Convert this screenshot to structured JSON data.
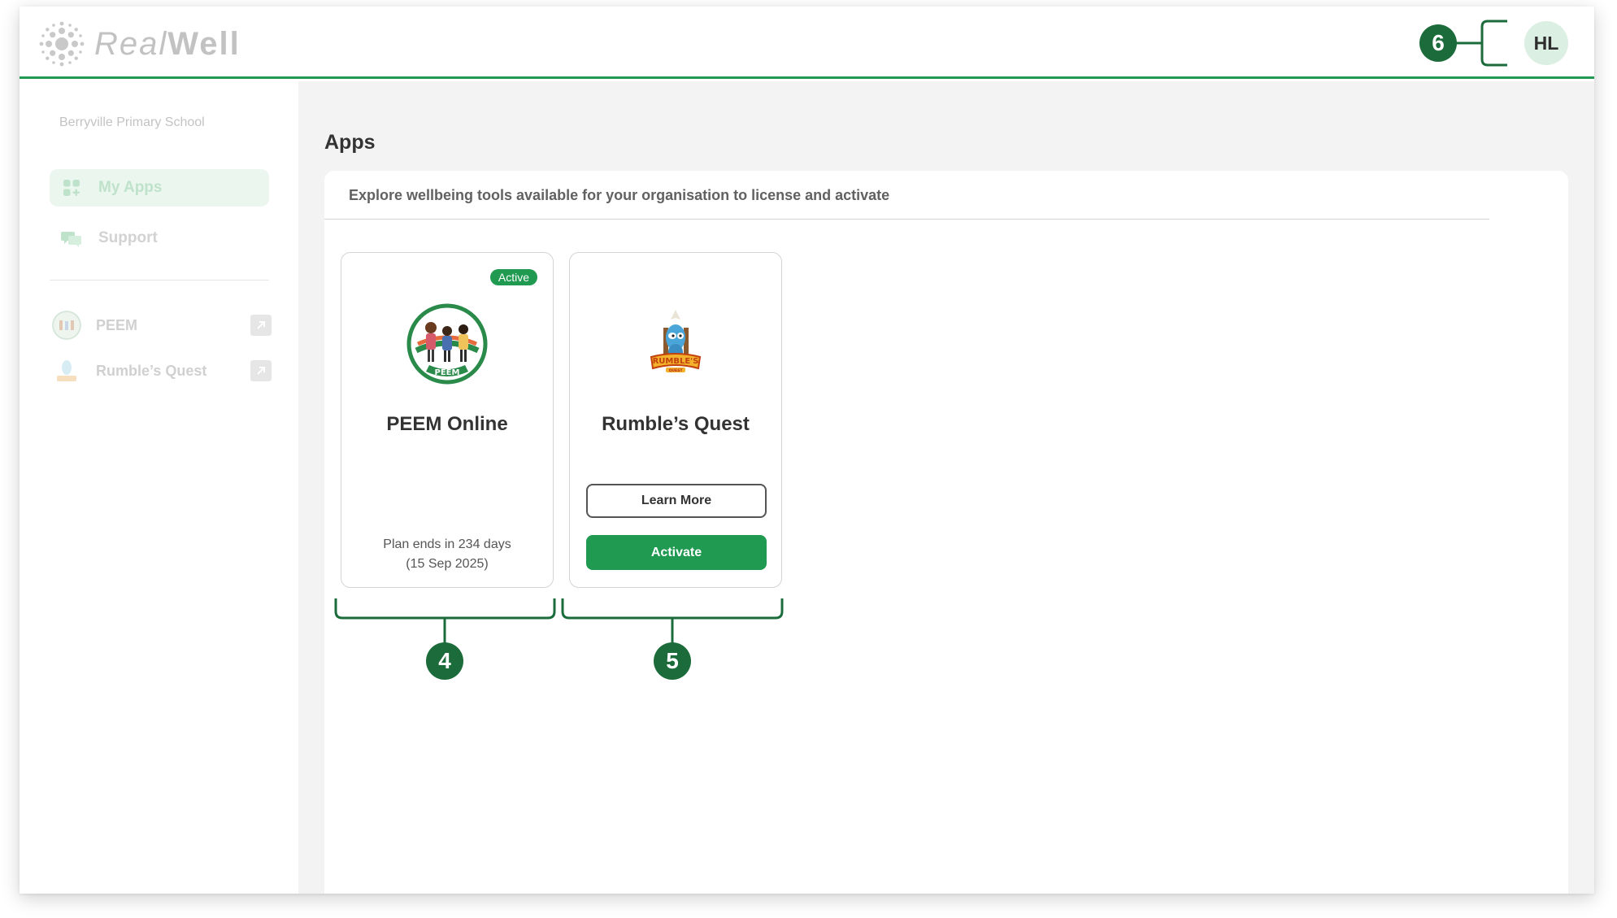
{
  "brand": {
    "name_part1": "Real",
    "name_part2": "Well",
    "accent": "#1f9a50"
  },
  "header": {
    "avatar_initials": "HL"
  },
  "sidebar": {
    "org_name": "Berryville Primary School",
    "nav": [
      {
        "label": "My Apps",
        "icon": "grid-plus-icon",
        "active": true
      },
      {
        "label": "Support",
        "icon": "chat-bubbles-icon",
        "active": false
      }
    ],
    "external": [
      {
        "label": "PEEM",
        "icon": "peem-logo",
        "link_icon": "external-link-icon"
      },
      {
        "label": "Rumble’s Quest",
        "icon": "rumbles-quest-logo",
        "link_icon": "external-link-icon"
      }
    ]
  },
  "main": {
    "title": "Apps",
    "subtitle": "Explore wellbeing tools available for your organisation to license and activate",
    "cards": [
      {
        "name": "PEEM Online",
        "badge": "Active",
        "plan_line1": "Plan ends in 234 days",
        "plan_line2": "(15 Sep 2025)"
      },
      {
        "name": "Rumble’s Quest",
        "learn_more": "Learn More",
        "activate": "Activate"
      }
    ]
  },
  "callouts": {
    "c4": "4",
    "c5": "5",
    "c6": "6",
    "color": "#1c6b3b"
  }
}
